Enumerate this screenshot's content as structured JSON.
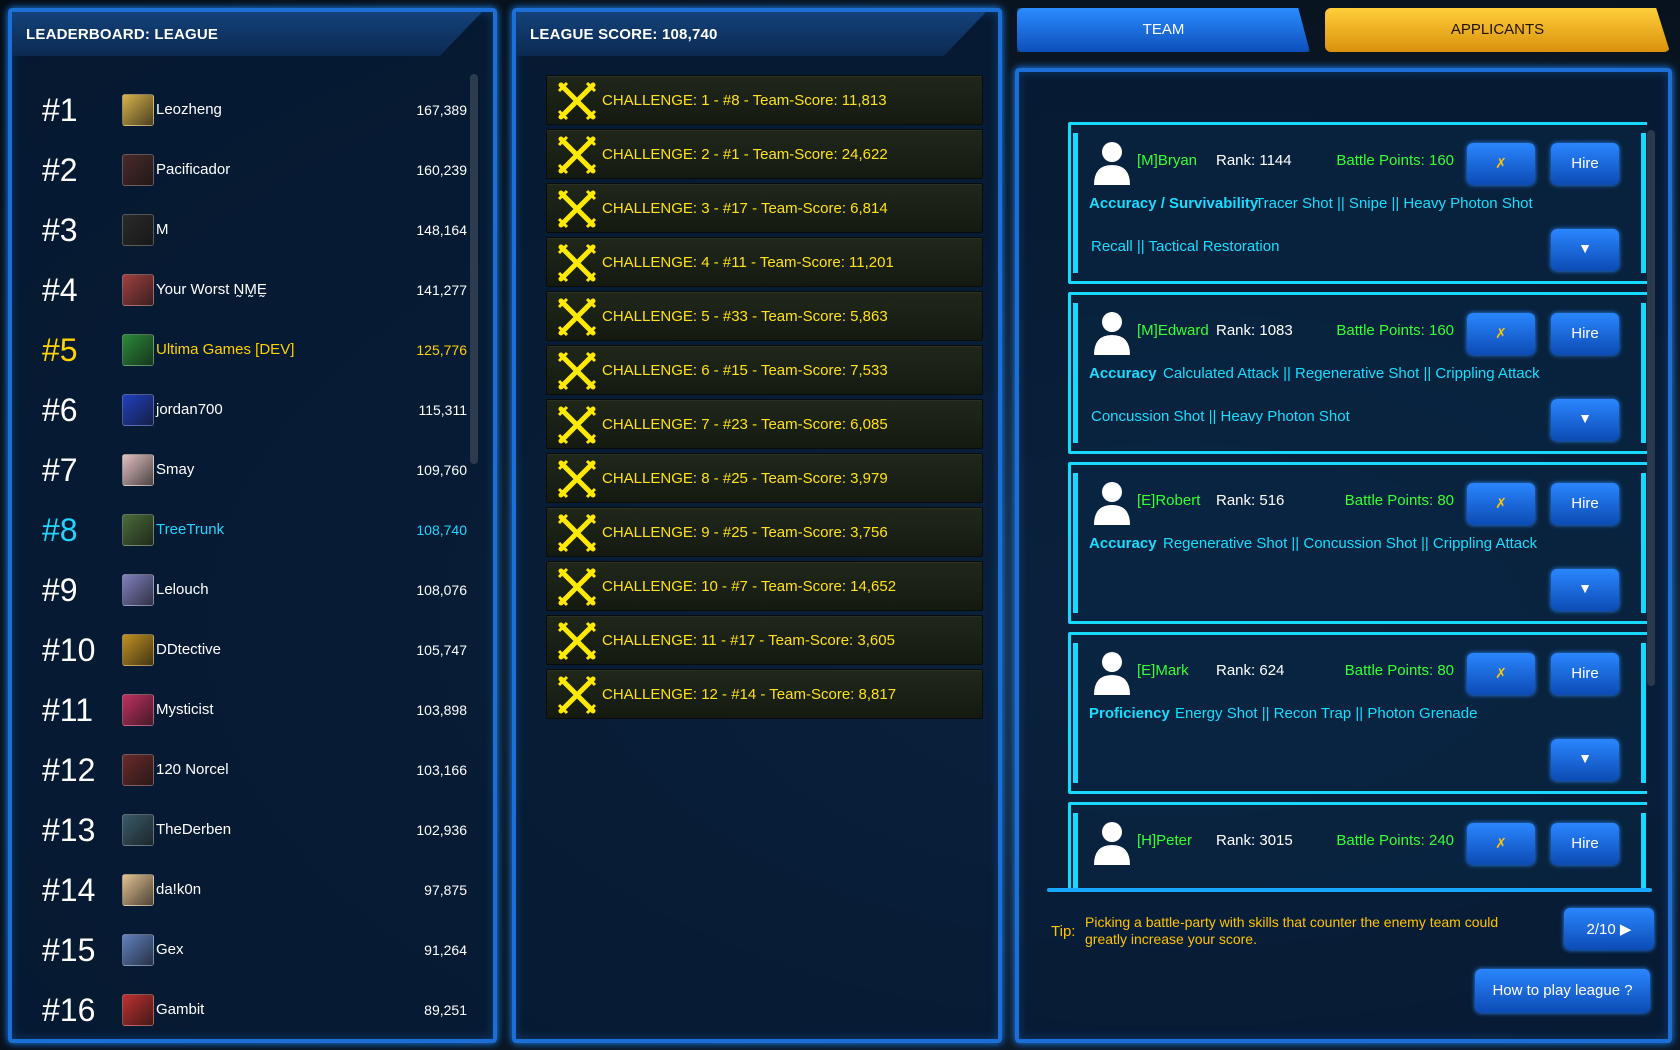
{
  "leaderboard": {
    "title": "LEADERBOARD: LEAGUE",
    "rows": [
      {
        "rank": "#1",
        "name": "Leozheng",
        "score": "167,389",
        "avatar_color": "#d8b34a"
      },
      {
        "rank": "#2",
        "name": "Pacificador",
        "score": "160,239",
        "avatar_color": "#4a2a2a"
      },
      {
        "rank": "#3",
        "name": "M",
        "score": "148,164",
        "avatar_color": "#2a2a2a"
      },
      {
        "rank": "#4",
        "name": "Your Worst N̰M̰Ḛ",
        "score": "141,277",
        "avatar_color": "#a04040"
      },
      {
        "rank": "#5",
        "name": "Ultima Games [DEV]",
        "score": "125,776",
        "avatar_color": "#2a8a3a",
        "highlight": "gold"
      },
      {
        "rank": "#6",
        "name": "jordan700",
        "score": "115,311",
        "avatar_color": "#2040c0"
      },
      {
        "rank": "#7",
        "name": "Smay",
        "score": "109,760",
        "avatar_color": "#e0c0c0"
      },
      {
        "rank": "#8",
        "name": "TreeTrunk",
        "score": "108,740",
        "avatar_color": "#4a6a3a",
        "highlight": "cyan"
      },
      {
        "rank": "#9",
        "name": "Lelouch",
        "score": "108,076",
        "avatar_color": "#8080c0"
      },
      {
        "rank": "#10",
        "name": "DDtective",
        "score": "105,747",
        "avatar_color": "#c09020"
      },
      {
        "rank": "#11",
        "name": "Mysticist",
        "score": "103,898",
        "avatar_color": "#c03060"
      },
      {
        "rank": "#12",
        "name": "120 Norcel",
        "score": "103,166",
        "avatar_color": "#6a2a2a"
      },
      {
        "rank": "#13",
        "name": "TheDerben",
        "score": "102,936",
        "avatar_color": "#3a5a6a"
      },
      {
        "rank": "#14",
        "name": "da!k0n",
        "score": "97,875",
        "avatar_color": "#e0c090"
      },
      {
        "rank": "#15",
        "name": "Gex",
        "score": "91,264",
        "avatar_color": "#6080c0"
      },
      {
        "rank": "#16",
        "name": "Gambit",
        "score": "89,251",
        "avatar_color": "#c03030"
      }
    ]
  },
  "league": {
    "title": "LEAGUE SCORE: 108,740",
    "challenges": [
      "CHALLENGE: 1 - #8 -  Team-Score: 11,813",
      "CHALLENGE: 2 - #1 -  Team-Score: 24,622",
      "CHALLENGE: 3 - #17 -  Team-Score: 6,814",
      "CHALLENGE: 4 - #11 -  Team-Score: 11,201",
      "CHALLENGE: 5 - #33 -  Team-Score: 5,863",
      "CHALLENGE: 6 - #15 -  Team-Score: 7,533",
      "CHALLENGE: 7 - #23 -  Team-Score: 6,085",
      "CHALLENGE: 8 - #25 -  Team-Score: 3,979",
      "CHALLENGE: 9 - #25 -  Team-Score: 3,756",
      "CHALLENGE: 10 - #7 -  Team-Score: 14,652",
      "CHALLENGE: 11 - #17 -  Team-Score: 3,605",
      "CHALLENGE: 12 - #14 -  Team-Score: 8,817"
    ],
    "icon": "crossed-swords-icon"
  },
  "tabs": {
    "team": "TEAM",
    "applicants": "APPLICANTS"
  },
  "applicants": [
    {
      "name": "[M]Bryan",
      "rank": "Rank: 1144",
      "bp": "Battle Points: 160",
      "class": "Accuracy / Survivability",
      "skills1": "Tracer Shot || Snipe || Heavy Photon Shot",
      "skills2": "Recall || Tactical Restoration",
      "reject": "✗",
      "hire": "Hire",
      "more": "▼"
    },
    {
      "name": "[M]Edward",
      "rank": "Rank: 1083",
      "bp": "Battle Points: 160",
      "class": "Accuracy",
      "skills1": "Calculated Attack || Regenerative Shot || Crippling Attack",
      "skills2": "Concussion Shot || Heavy Photon Shot",
      "reject": "✗",
      "hire": "Hire",
      "more": "▼"
    },
    {
      "name": "[E]Robert",
      "rank": "Rank: 516",
      "bp": "Battle Points: 80",
      "class": "Accuracy",
      "skills1": "Regenerative Shot || Concussion Shot || Crippling Attack",
      "skills2": "",
      "reject": "✗",
      "hire": "Hire",
      "more": "▼"
    },
    {
      "name": "[E]Mark",
      "rank": "Rank: 624",
      "bp": "Battle Points: 80",
      "class": "Proficiency",
      "skills1": "Energy Shot || Recon Trap || Photon Grenade",
      "skills2": "",
      "reject": "✗",
      "hire": "Hire",
      "more": "▼"
    },
    {
      "name": "[H]Peter",
      "rank": "Rank: 3015",
      "bp": "Battle Points: 240",
      "class": "",
      "skills1": "",
      "skills2": "",
      "reject": "✗",
      "hire": "Hire",
      "more": "▼"
    }
  ],
  "tip": {
    "label": "Tip:",
    "text": "Picking a battle-party with skills that counter the enemy team could greatly increase your score.",
    "page": "2/10 ▶"
  },
  "how_to_play": "How to play league ?",
  "colors": {
    "panel_border": "#1c6fd6",
    "highlight_gold": "#ffd200",
    "highlight_cyan": "#1fd6ff",
    "challenge_text": "#ffe21a",
    "applicant_name": "#35ff35",
    "skill_text": "#18ddff"
  }
}
